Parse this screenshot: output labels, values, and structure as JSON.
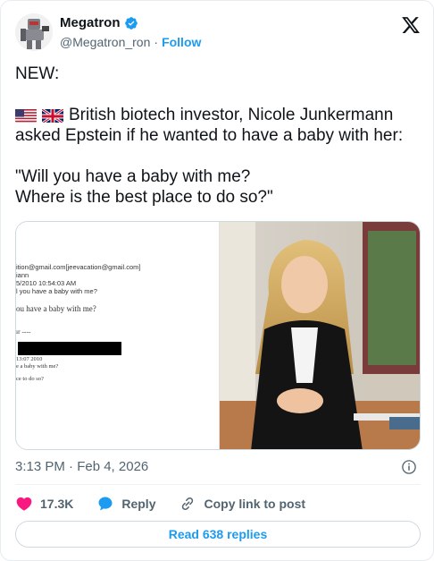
{
  "author": {
    "display_name": "Megatron",
    "handle": "@Megatron_ron",
    "separator": "·",
    "follow_label": "Follow",
    "verified_color": "#1d9bf0"
  },
  "tweet": {
    "line1": "NEW:",
    "line2": "British biotech investor, Nicole Junkermann asked Epstein if he wanted to have a baby with her:",
    "line3": "\"Will you have a baby with me?",
    "line4": "Where is the best place to do so?\"",
    "flags": [
      "us-flag-icon",
      "uk-flag-icon"
    ]
  },
  "document": {
    "lines": [
      "ition@gmail.com[jeevacation@gmail.com]",
      "iann",
      "5/2010 10:54:03 AM",
      "l you have a baby with me?",
      "ou have a baby with me?",
      "ır ----",
      "13:07 2010",
      "e a baby with me?",
      "ce to do so?"
    ]
  },
  "timestamp": "3:13 PM · Feb 4, 2026",
  "actions": {
    "likes": "17.3K",
    "reply_label": "Reply",
    "copy_label": "Copy link to post"
  },
  "read_replies_label": "Read 638 replies",
  "colors": {
    "accent": "#1d9bf0",
    "like": "#f91880",
    "text": "#0f1419",
    "muted": "#536471"
  }
}
